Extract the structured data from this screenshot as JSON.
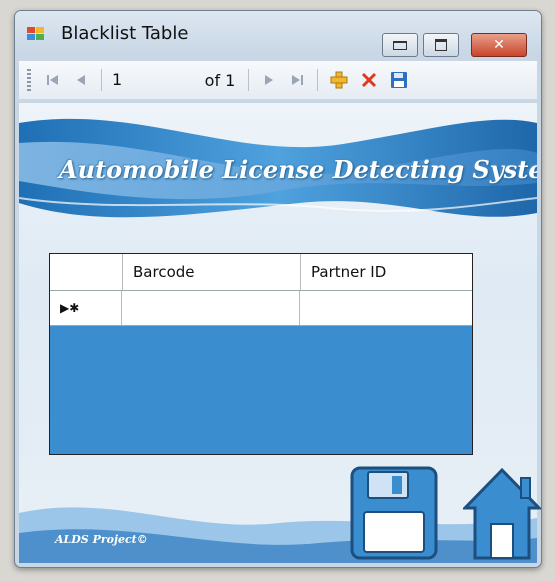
{
  "window": {
    "title": "Blacklist Table",
    "controls": {
      "minimize": "minimize",
      "maximize": "maximize",
      "close": "close"
    }
  },
  "toolbar": {
    "position_value": "1",
    "count_label": "of 1",
    "buttons": [
      "move-first",
      "move-previous",
      "move-next",
      "move-last",
      "add-new",
      "delete",
      "save"
    ]
  },
  "banner": {
    "title": "Automobile License Detecting System"
  },
  "grid": {
    "columns": [
      "Barcode",
      "Partner ID"
    ],
    "new_row_indicator": "▶✱",
    "rows": [
      {
        "barcode": "",
        "partner_id": ""
      }
    ]
  },
  "footer": {
    "credit": "ALDS Project©"
  },
  "colors": {
    "grid_background": "#3a8ed0",
    "banner_blue": "#2b7fc4",
    "close_button": "#c8452b"
  }
}
